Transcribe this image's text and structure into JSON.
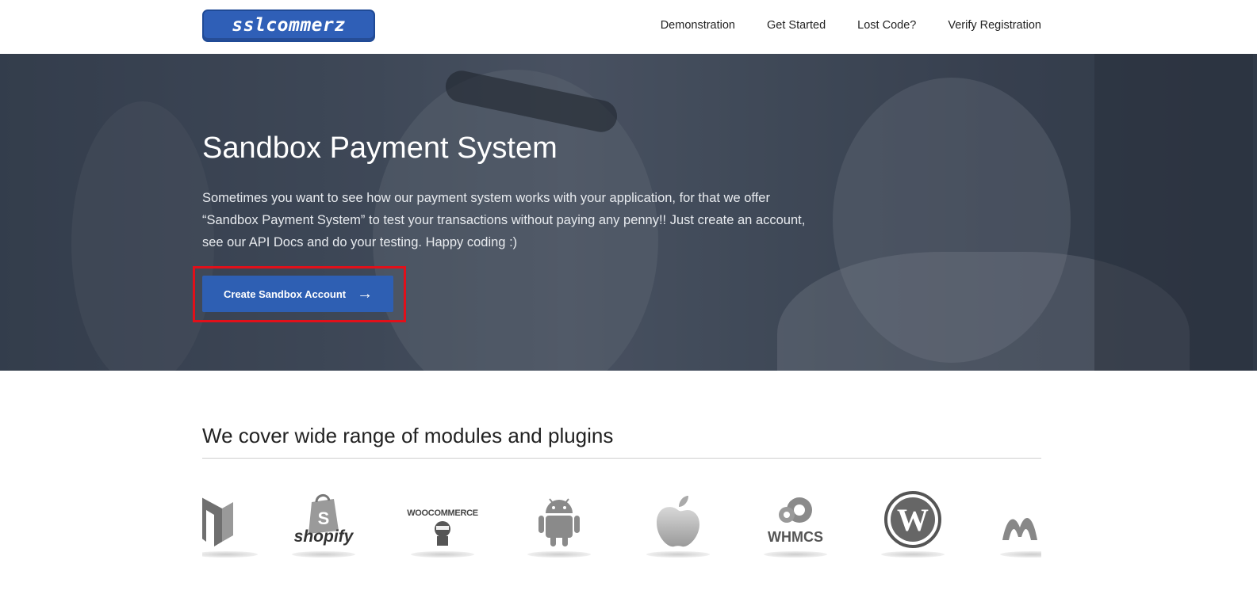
{
  "header": {
    "logo_text": "sslcommerz",
    "nav": [
      "Demonstration",
      "Get Started",
      "Lost Code?",
      "Verify Registration"
    ]
  },
  "hero": {
    "title": "Sandbox Payment System",
    "description": "Sometimes you want to see how our payment system works with your application, for that we offer “Sandbox Payment System” to test your transactions without paying any penny!! Just create an account, see our API Docs and do your testing. Happy coding :)",
    "cta_label": "Create Sandbox Account",
    "cta_icon": "arrow-right-icon"
  },
  "modules": {
    "title": "We cover wide range of modules and plugins",
    "plugins": [
      {
        "name": "magento-icon"
      },
      {
        "name": "shopify-icon",
        "label": "shopify"
      },
      {
        "name": "woocommerce-icon",
        "label": "WOOCOMMERCE"
      },
      {
        "name": "android-icon"
      },
      {
        "name": "apple-icon"
      },
      {
        "name": "whmcs-icon",
        "label": "WHMCS"
      },
      {
        "name": "wordpress-icon"
      },
      {
        "name": "microsoft-icon"
      }
    ]
  },
  "colors": {
    "brand_blue": "#2e5fb3",
    "highlight_red": "#e1101a"
  }
}
